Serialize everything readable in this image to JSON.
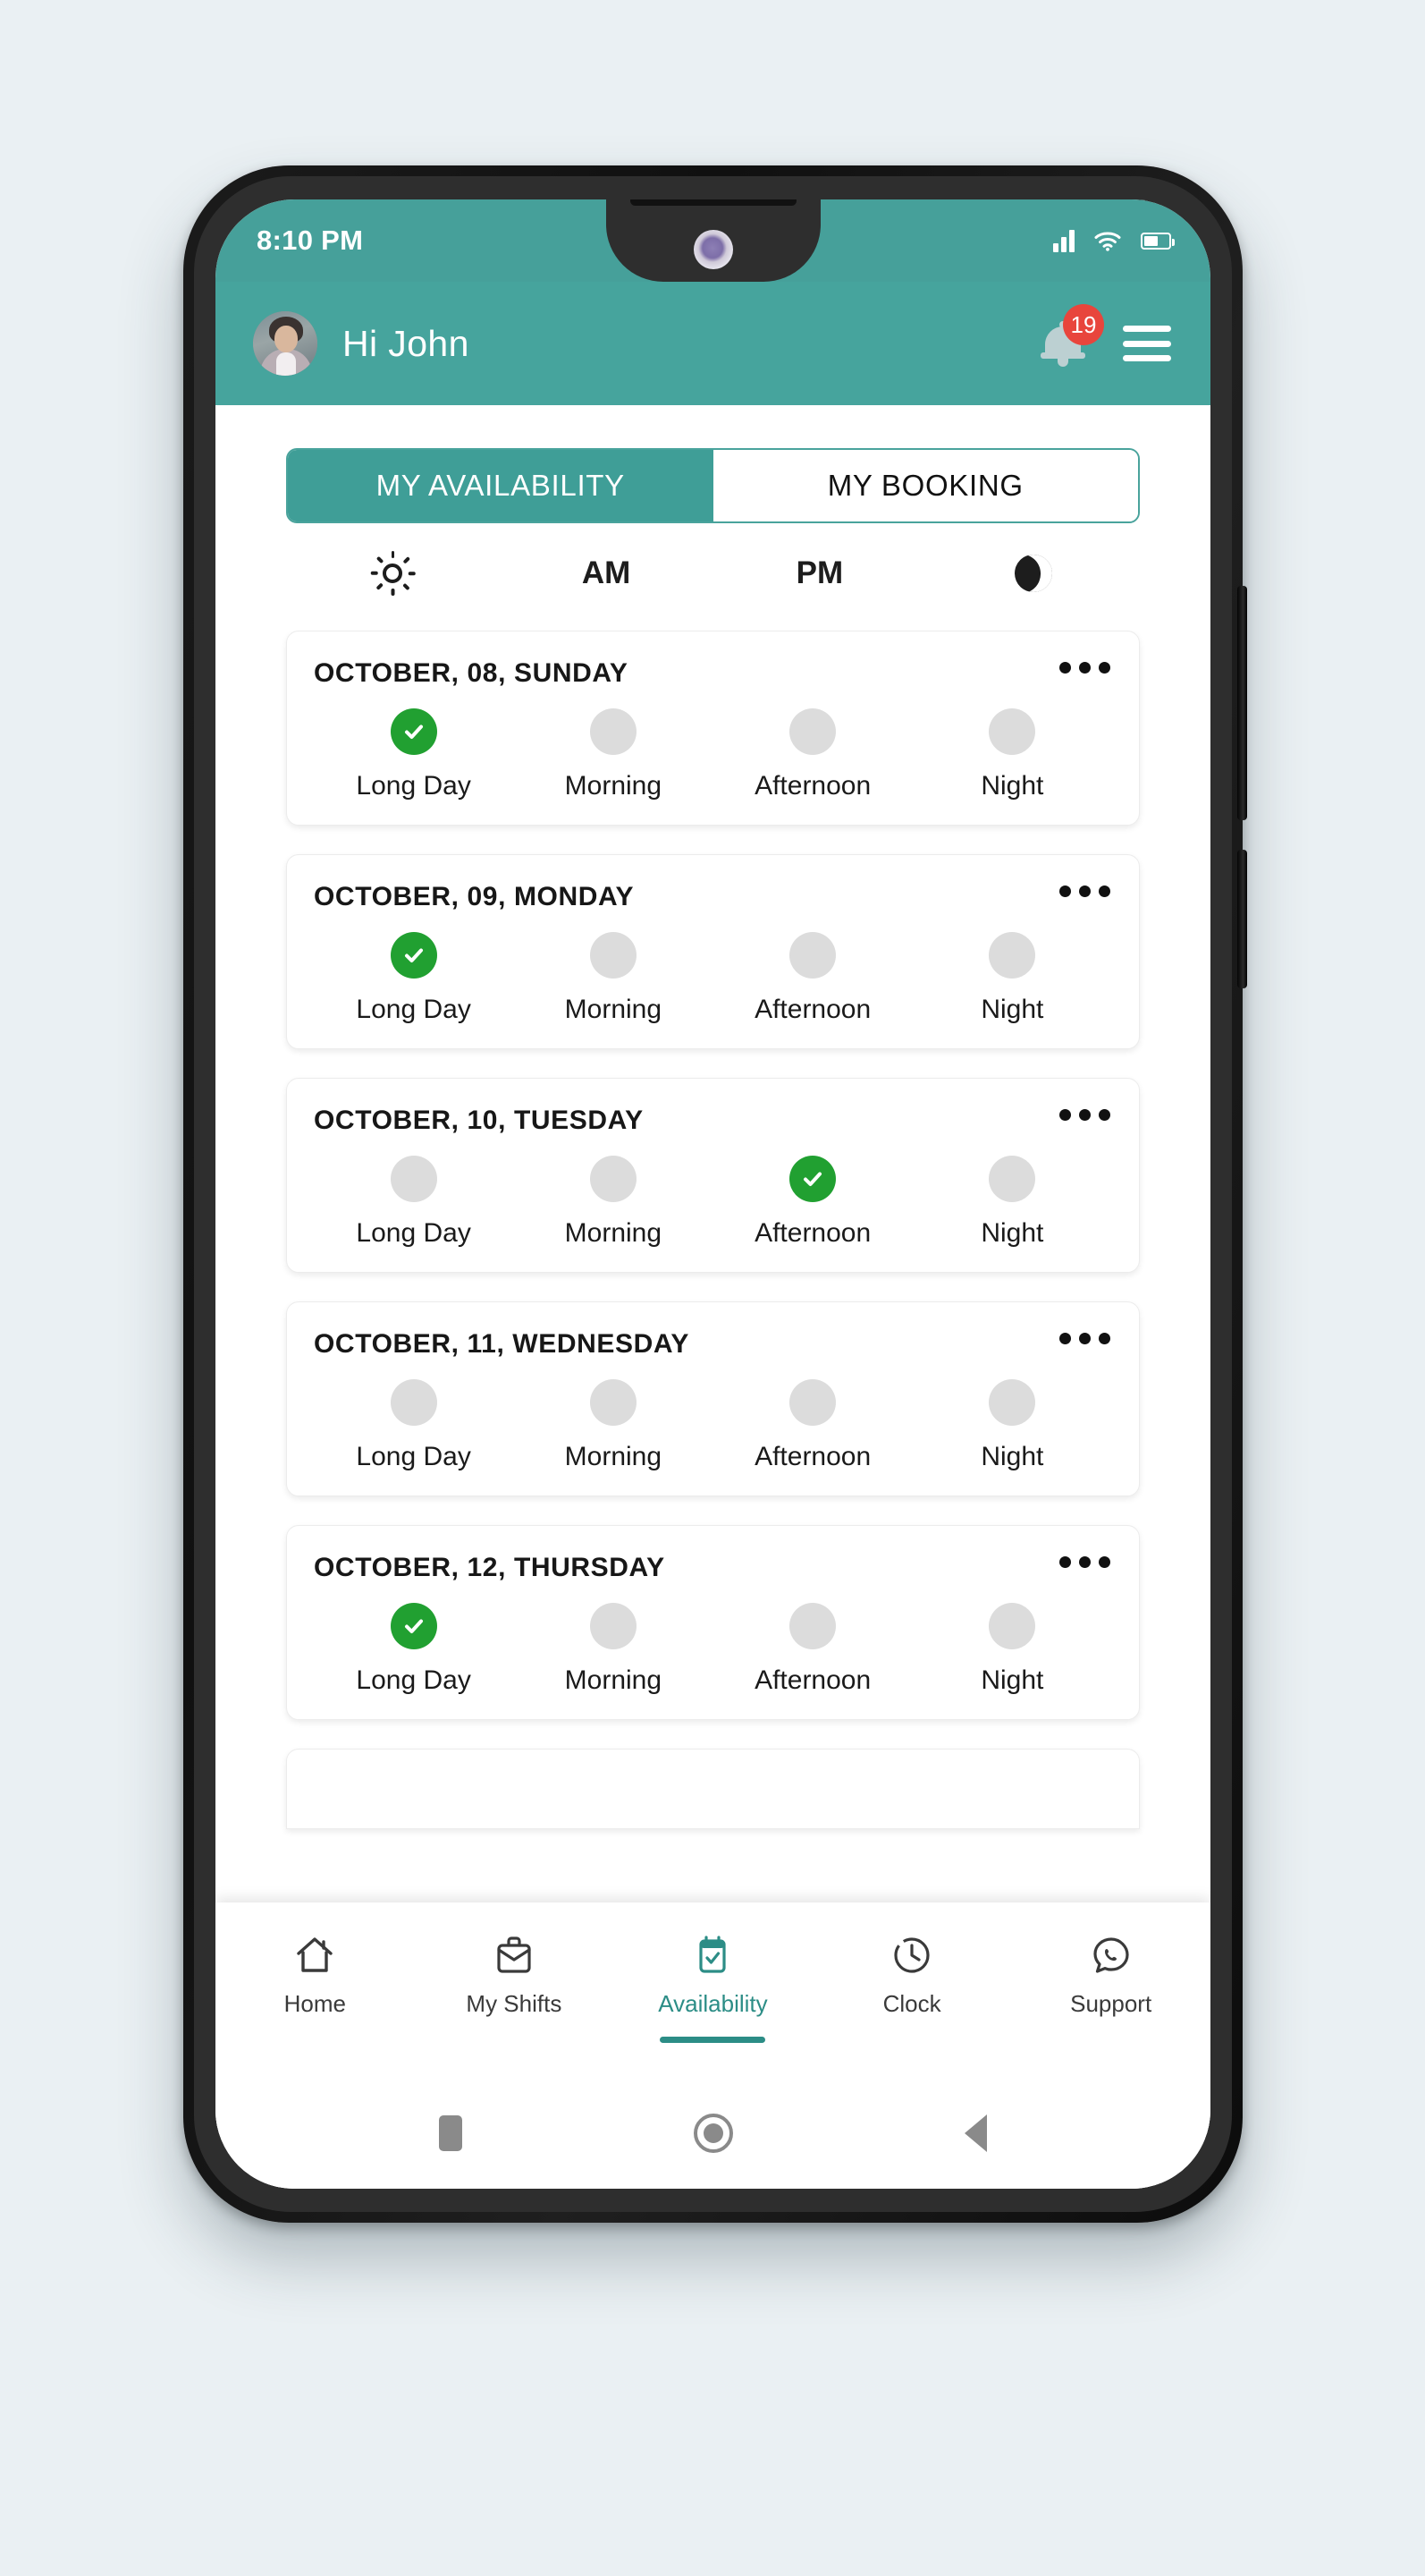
{
  "theme": {
    "teal": "#46a49d",
    "teal_dark": "#3f9e97",
    "status_bar_teal": "#46a09a",
    "green_selected": "#21a031",
    "gray_unselected": "#dcdcdc",
    "badge_red": "#e8453c",
    "page_background": "#eaf0f3",
    "nav_active": "#2c8d86"
  },
  "status_bar": {
    "time": "8:10 PM",
    "signal_icon": "signal-bars-icon",
    "wifi_icon": "wifi-icon",
    "battery_icon": "battery-icon",
    "battery_level_pct": 58
  },
  "header": {
    "avatar_icon": "avatar",
    "greeting": "Hi John",
    "bell_icon": "notification-bell-icon",
    "notification_count": "19",
    "menu_icon": "hamburger-menu-icon"
  },
  "tabs": [
    {
      "label": "MY AVAILABILITY",
      "active": true
    },
    {
      "label": "MY BOOKING",
      "active": false
    }
  ],
  "period_header": [
    {
      "type": "icon",
      "icon": "sun-icon",
      "label": ""
    },
    {
      "type": "text",
      "icon": "",
      "label": "AM"
    },
    {
      "type": "text",
      "icon": "",
      "label": "PM"
    },
    {
      "type": "icon",
      "icon": "moon-icon",
      "label": ""
    }
  ],
  "shift_names": [
    "Long Day",
    "Morning",
    "Afternoon",
    "Night"
  ],
  "menu_icon_name": "three-dots-menu-icon",
  "days": [
    {
      "date": "OCTOBER, 08, SUNDAY",
      "slots": [
        {
          "label": "Long Day",
          "selected": true
        },
        {
          "label": "Morning",
          "selected": false
        },
        {
          "label": "Afternoon",
          "selected": false
        },
        {
          "label": "Night",
          "selected": false
        }
      ]
    },
    {
      "date": "OCTOBER, 09, MONDAY",
      "slots": [
        {
          "label": "Long Day",
          "selected": true
        },
        {
          "label": "Morning",
          "selected": false
        },
        {
          "label": "Afternoon",
          "selected": false
        },
        {
          "label": "Night",
          "selected": false
        }
      ]
    },
    {
      "date": "OCTOBER, 10, TUESDAY",
      "slots": [
        {
          "label": "Long Day",
          "selected": false
        },
        {
          "label": "Morning",
          "selected": false
        },
        {
          "label": "Afternoon",
          "selected": true
        },
        {
          "label": "Night",
          "selected": false
        }
      ]
    },
    {
      "date": "OCTOBER, 11, WEDNESDAY",
      "slots": [
        {
          "label": "Long Day",
          "selected": false
        },
        {
          "label": "Morning",
          "selected": false
        },
        {
          "label": "Afternoon",
          "selected": false
        },
        {
          "label": "Night",
          "selected": false
        }
      ]
    },
    {
      "date": "OCTOBER, 12, THURSDAY",
      "slots": [
        {
          "label": "Long Day",
          "selected": true
        },
        {
          "label": "Morning",
          "selected": false
        },
        {
          "label": "Afternoon",
          "selected": false
        },
        {
          "label": "Night",
          "selected": false
        }
      ]
    }
  ],
  "bottom_nav": [
    {
      "label": "Home",
      "icon": "home-icon",
      "active": false
    },
    {
      "label": "My Shifts",
      "icon": "briefcase-icon",
      "active": false
    },
    {
      "label": "Availability",
      "icon": "calendar-check-icon",
      "active": true
    },
    {
      "label": "Clock",
      "icon": "clock-icon",
      "active": false
    },
    {
      "label": "Support",
      "icon": "whatsapp-support-icon",
      "active": false
    }
  ],
  "system_nav": [
    {
      "icon": "recents-square-icon"
    },
    {
      "icon": "home-circle-icon"
    },
    {
      "icon": "back-triangle-icon"
    }
  ]
}
